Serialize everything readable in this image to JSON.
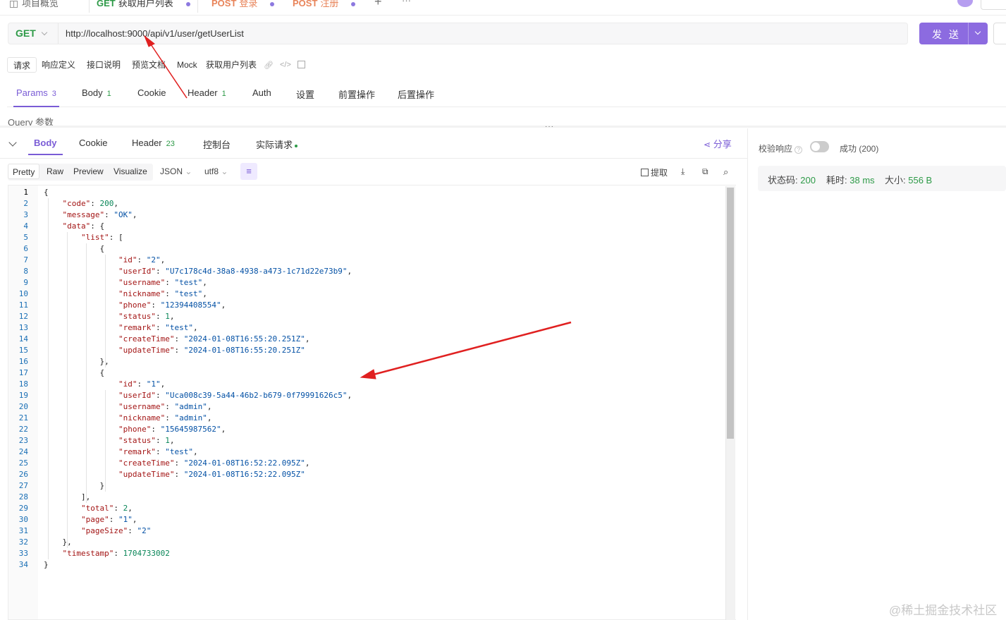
{
  "tabs": [
    {
      "method": "",
      "label": "项目概览"
    },
    {
      "method": "GET",
      "label": "获取用户列表"
    },
    {
      "method": "POST",
      "label": "登录"
    },
    {
      "method": "POST",
      "label": "注册"
    }
  ],
  "tab_add": "+",
  "tab_more": "···",
  "tab_colors": {
    "get": "#2e9a48",
    "post": "#e8845a",
    "accent": "#7a5cd6"
  },
  "request": {
    "method": "GET",
    "url": "http://localhost:9000/api/v1/user/getUserList",
    "send_label": "发 送"
  },
  "subtabs": [
    "请求",
    "响应定义",
    "接口说明",
    "预览文档",
    "Mock",
    "获取用户列表"
  ],
  "param_tabs": [
    {
      "label": "Params",
      "count": "3"
    },
    {
      "label": "Body",
      "count": "1"
    },
    {
      "label": "Cookie",
      "count": ""
    },
    {
      "label": "Header",
      "count": "1"
    },
    {
      "label": "Auth",
      "count": ""
    },
    {
      "label": "设置",
      "count": ""
    },
    {
      "label": "前置操作",
      "count": ""
    },
    {
      "label": "后置操作",
      "count": ""
    }
  ],
  "query_label": "Query 参数",
  "response_tabs": [
    {
      "label": "Body",
      "count": ""
    },
    {
      "label": "Cookie",
      "count": ""
    },
    {
      "label": "Header",
      "count": "23"
    },
    {
      "label": "控制台",
      "count": ""
    },
    {
      "label": "实际请求",
      "count": ""
    }
  ],
  "share_label": "分享",
  "format_buttons": [
    "Pretty",
    "Raw",
    "Preview",
    "Visualize"
  ],
  "format_json": "JSON",
  "format_encoding": "utf8",
  "tool_extract": "提取",
  "validate_label": "校验响应",
  "validate_help": "?",
  "result_label": "成功 (200)",
  "status": {
    "code_label": "状态码:",
    "code": "200",
    "time_label": "耗时:",
    "time": "38 ms",
    "size_label": "大小:",
    "size": "556 B"
  },
  "code_lines": [
    "{",
    "    \"code\": 200,",
    "    \"message\": \"OK\",",
    "    \"data\": {",
    "        \"list\": [",
    "            {",
    "                \"id\": \"2\",",
    "                \"userId\": \"U7c178c4d-38a8-4938-a473-1c71d22e73b9\",",
    "                \"username\": \"test\",",
    "                \"nickname\": \"test\",",
    "                \"phone\": \"12394408554\",",
    "                \"status\": 1,",
    "                \"remark\": \"test\",",
    "                \"createTime\": \"2024-01-08T16:55:20.251Z\",",
    "                \"updateTime\": \"2024-01-08T16:55:20.251Z\"",
    "            },",
    "            {",
    "                \"id\": \"1\",",
    "                \"userId\": \"Uca008c39-5a44-46b2-b679-0f79991626c5\",",
    "                \"username\": \"admin\",",
    "                \"nickname\": \"admin\",",
    "                \"phone\": \"15645987562\",",
    "                \"status\": 1,",
    "                \"remark\": \"test\",",
    "                \"createTime\": \"2024-01-08T16:52:22.095Z\",",
    "                \"updateTime\": \"2024-01-08T16:52:22.095Z\"",
    "            }",
    "        ],",
    "        \"total\": 2,",
    "        \"page\": \"1\",",
    "        \"pageSize\": \"2\"",
    "    },",
    "    \"timestamp\": 1704733002",
    "}"
  ],
  "watermark": "@稀土掘金技术社区",
  "annotation_color": "#e02020"
}
